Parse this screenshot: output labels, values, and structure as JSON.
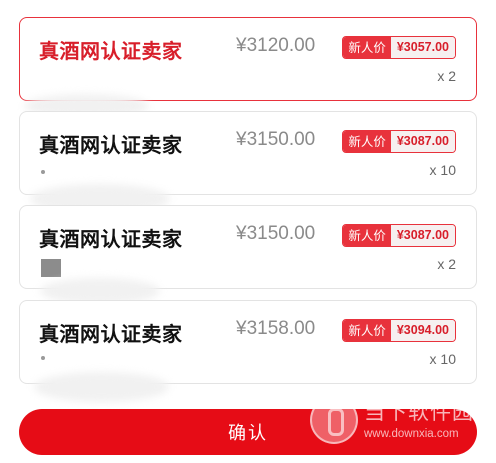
{
  "offers": [
    {
      "seller": "真酒网认证卖家",
      "price": "¥3120.00",
      "promo_tag": "新人价",
      "promo_price": "¥3057.00",
      "quantity": "x 2",
      "selected": true
    },
    {
      "seller": "真酒网认证卖家",
      "price": "¥3150.00",
      "promo_tag": "新人价",
      "promo_price": "¥3087.00",
      "quantity": "x 10",
      "selected": false
    },
    {
      "seller": "真酒网认证卖家",
      "price": "¥3150.00",
      "promo_tag": "新人价",
      "promo_price": "¥3087.00",
      "quantity": "x 2",
      "selected": false
    },
    {
      "seller": "真酒网认证卖家",
      "price": "¥3158.00",
      "promo_tag": "新人价",
      "promo_price": "¥3094.00",
      "quantity": "x 10",
      "selected": false
    }
  ],
  "confirm_label": "确认",
  "watermark": {
    "name": "当下软件园",
    "url": "www.downxia.com"
  },
  "colors": {
    "accent": "#e60c16",
    "selected_text": "#d81e2a"
  }
}
